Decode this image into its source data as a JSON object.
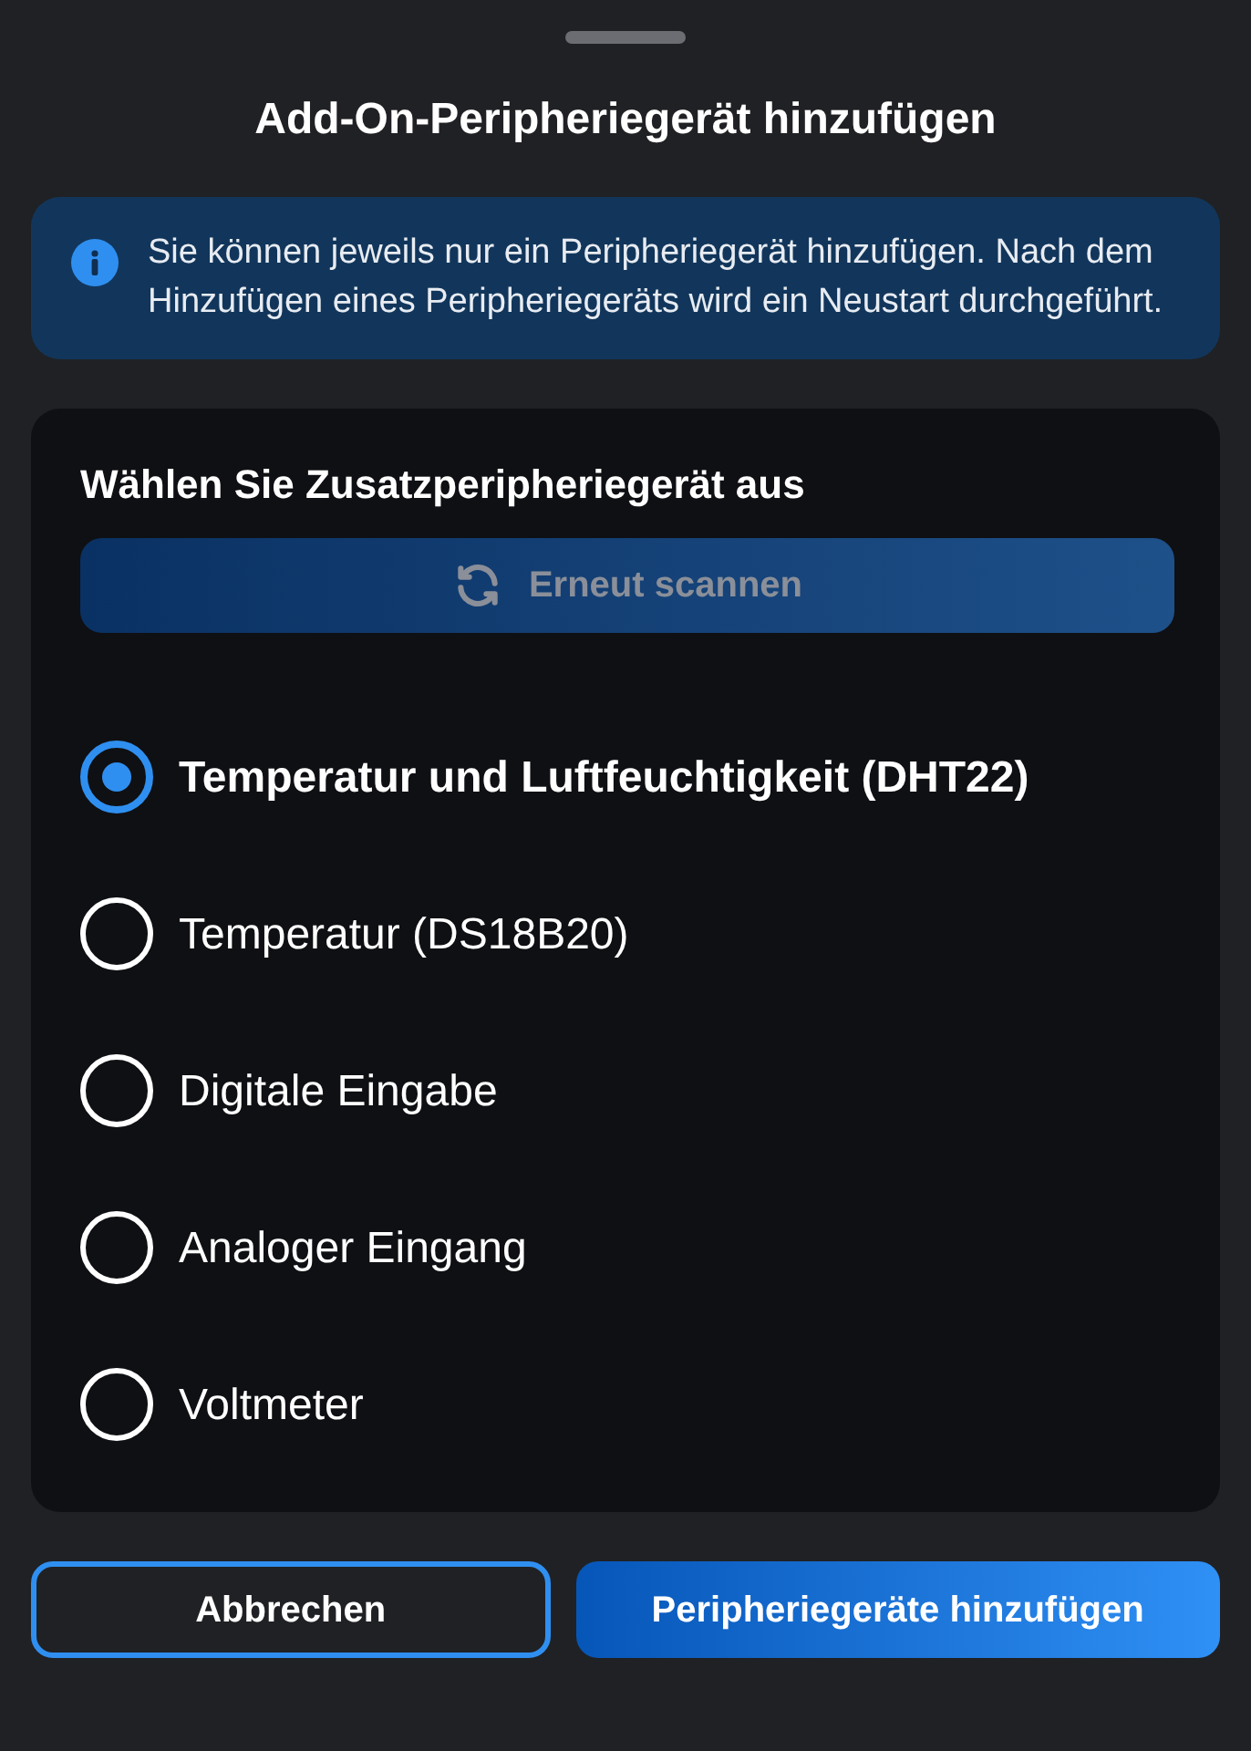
{
  "title": "Add-On-Peripheriegerät hinzufügen",
  "info": {
    "text": "Sie können jeweils nur ein Peripheriegerät hinzufügen. Nach dem Hinzufügen eines Peripheriegeräts wird ein Neustart durchgeführt."
  },
  "card": {
    "heading": "Wählen Sie Zusatzperipheriegerät aus",
    "scan_button": {
      "label": "Erneut scannen",
      "disabled": true
    },
    "options": [
      {
        "label": "Temperatur und Luftfeuchtigkeit (DHT22)",
        "selected": true
      },
      {
        "label": "Temperatur (DS18B20)",
        "selected": false
      },
      {
        "label": "Digitale Eingabe",
        "selected": false
      },
      {
        "label": "Analoger Eingang",
        "selected": false
      },
      {
        "label": "Voltmeter",
        "selected": false
      }
    ]
  },
  "buttons": {
    "cancel": "Abbrechen",
    "confirm": "Peripheriegeräte hinzufügen"
  }
}
